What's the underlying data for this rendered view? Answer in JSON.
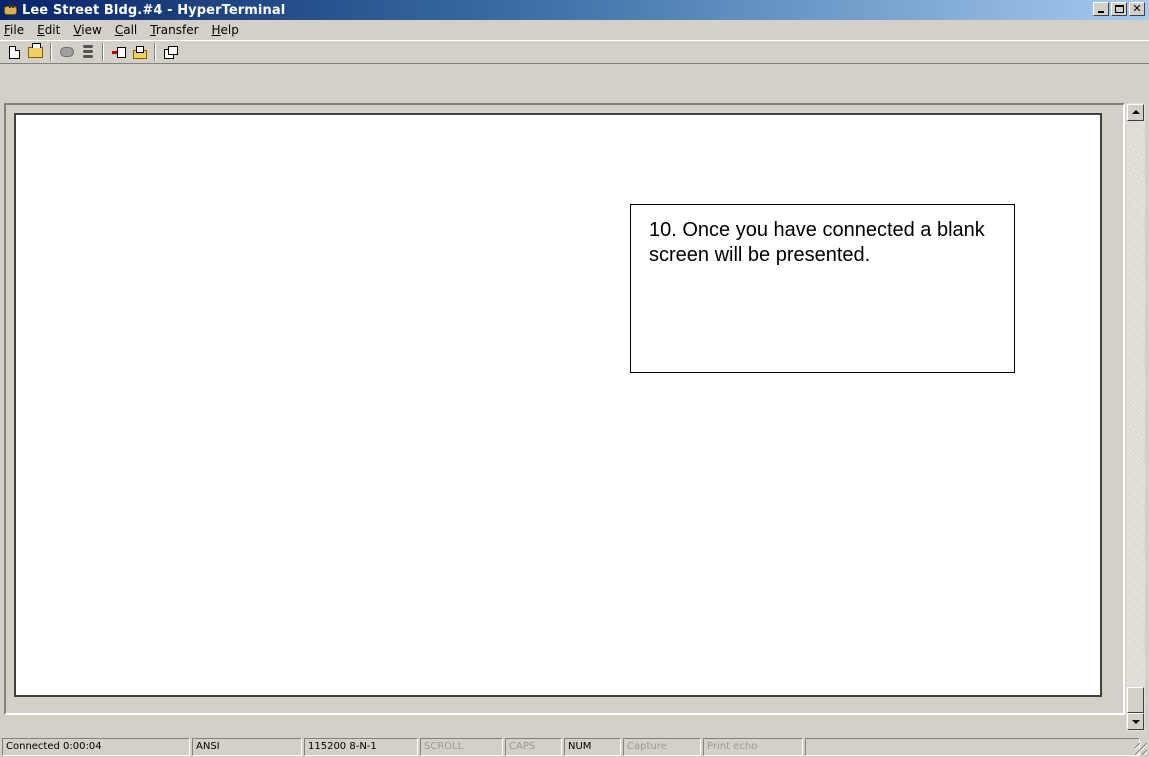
{
  "window": {
    "title": "Lee Street Bldg.#4 - HyperTerminal"
  },
  "menu": {
    "items": [
      {
        "first": "F",
        "rest": "ile"
      },
      {
        "first": "E",
        "rest": "dit"
      },
      {
        "first": "V",
        "rest": "iew"
      },
      {
        "first": "C",
        "rest": "all"
      },
      {
        "first": "T",
        "rest": "ransfer"
      },
      {
        "first": "H",
        "rest": "elp"
      }
    ]
  },
  "toolbar": {
    "icons": [
      "new-icon",
      "open-icon",
      "disconnect-icon",
      "hang-up-icon",
      "send-icon",
      "receive-icon",
      "properties-icon"
    ]
  },
  "callout": {
    "text": "10.  Once you have connected a blank screen will be presented."
  },
  "status": {
    "connected": "Connected 0:00:04",
    "emulation": "ANSI",
    "settings": "115200 8-N-1",
    "scroll": "SCROLL",
    "caps": "CAPS",
    "num": "NUM",
    "capture": "Capture",
    "print_echo": "Print echo"
  },
  "colors": {
    "title_gradient_start": "#0a246a",
    "title_gradient_end": "#a6caf0",
    "chrome": "#d4d0c8"
  }
}
